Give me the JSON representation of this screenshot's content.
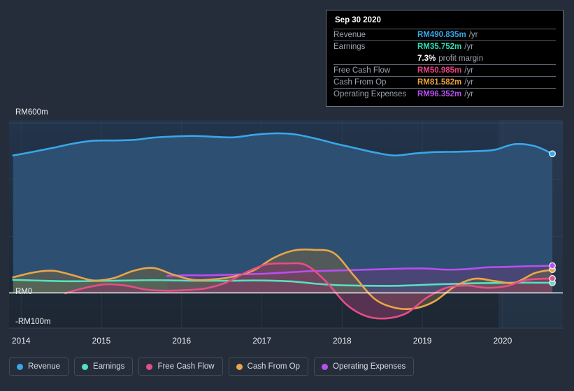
{
  "theme": {
    "background": "#262d3a",
    "plot_bg_top": "#22344b",
    "plot_bg_bottom": "#1d2733",
    "axis_text": "#e9edf2",
    "grid": "#3a4656",
    "zero_line": "#ffffff",
    "forecast_band": "#2c4059",
    "tooltip_bg": "#000000",
    "tooltip_border": "#6d747f",
    "tooltip_rule": "#5d646f",
    "tooltip_key": "#9aa1ac"
  },
  "tooltip": {
    "date": "Sep 30 2020",
    "rows": [
      {
        "key": "Revenue",
        "value": "RM490.835m",
        "unit": "/yr",
        "color": "#3aa6e8"
      },
      {
        "key": "Earnings",
        "value": "RM35.752m",
        "unit": "/yr",
        "color": "#2ee0b4"
      },
      {
        "key": "Free Cash Flow",
        "value": "RM50.985m",
        "unit": "/yr",
        "color": "#e8417f"
      },
      {
        "key": "Cash From Op",
        "value": "RM81.582m",
        "unit": "/yr",
        "color": "#e8a33d"
      },
      {
        "key": "Operating Expenses",
        "value": "RM96.352m",
        "unit": "/yr",
        "color": "#b44ff0"
      }
    ],
    "margin_value": "7.3%",
    "margin_label": "profit margin"
  },
  "legend": {
    "items": [
      {
        "label": "Revenue",
        "color": "#3aa6e8"
      },
      {
        "label": "Earnings",
        "color": "#56e0c0"
      },
      {
        "label": "Free Cash Flow",
        "color": "#e34f86"
      },
      {
        "label": "Cash From Op",
        "color": "#e8a64a"
      },
      {
        "label": "Operating Expenses",
        "color": "#b84ff0"
      }
    ]
  },
  "chart_data": {
    "type": "area",
    "title": "",
    "xlabel": "",
    "ylabel": "",
    "currency": "RM",
    "grid": true,
    "legend_position": "bottom",
    "ylim": [
      -100,
      600
    ],
    "y_ticks": [
      {
        "value": 600,
        "label": "RM600m"
      },
      {
        "value": 0,
        "label": "RM0"
      },
      {
        "value": -100,
        "label": "-RM100m"
      }
    ],
    "x_tick_labels": [
      "2014",
      "2015",
      "2016",
      "2017",
      "2018",
      "2019",
      "2020"
    ],
    "x_range": [
      2013.85,
      2020.75
    ],
    "forecast_start": "2019.95",
    "series": [
      {
        "name": "Revenue",
        "color": "#3aa6e8",
        "fill": "#2d4f72",
        "x": [
          2013.9,
          2014.15,
          2014.4,
          2014.65,
          2014.9,
          2015.15,
          2015.4,
          2015.65,
          2015.9,
          2016.15,
          2016.4,
          2016.65,
          2016.9,
          2017.15,
          2017.4,
          2017.65,
          2017.9,
          2018.15,
          2018.4,
          2018.65,
          2018.9,
          2019.15,
          2019.4,
          2019.65,
          2019.9,
          2020.15,
          2020.4,
          2020.62
        ],
        "values": [
          485,
          498,
          512,
          527,
          537,
          538,
          540,
          548,
          552,
          554,
          551,
          549,
          558,
          563,
          560,
          546,
          528,
          512,
          496,
          485,
          492,
          497,
          498,
          500,
          505,
          525,
          518,
          491
        ]
      },
      {
        "name": "Earnings",
        "color": "#56e0c0",
        "fill": "#3e6e6a",
        "x": [
          2013.9,
          2014.15,
          2014.4,
          2014.65,
          2014.9,
          2015.15,
          2015.4,
          2015.65,
          2015.9,
          2016.15,
          2016.4,
          2016.65,
          2016.9,
          2017.15,
          2017.4,
          2017.65,
          2017.9,
          2018.15,
          2018.4,
          2018.65,
          2018.9,
          2019.15,
          2019.4,
          2019.65,
          2019.9,
          2020.15,
          2020.4,
          2020.62
        ],
        "values": [
          46,
          44,
          42,
          41,
          42,
          43,
          44,
          45,
          44,
          43,
          43,
          43,
          44,
          43,
          40,
          33,
          28,
          26,
          25,
          25,
          27,
          30,
          32,
          34,
          35,
          36,
          36,
          36
        ]
      },
      {
        "name": "Free Cash Flow",
        "color": "#e34f86",
        "fill": "#7a3a63",
        "x": [
          2014.55,
          2014.8,
          2015.05,
          2015.3,
          2015.55,
          2015.8,
          2016.05,
          2016.3,
          2016.55,
          2016.8,
          2017.05,
          2017.3,
          2017.55,
          2017.8,
          2018.05,
          2018.3,
          2018.55,
          2018.8,
          2019.05,
          2019.3,
          2019.55,
          2019.8,
          2020.05,
          2020.3,
          2020.62
        ],
        "values": [
          -1,
          18,
          30,
          26,
          12,
          8,
          10,
          16,
          36,
          72,
          100,
          104,
          98,
          40,
          -40,
          -82,
          -90,
          -72,
          -18,
          18,
          26,
          18,
          24,
          46,
          51
        ]
      },
      {
        "name": "Cash From Op",
        "color": "#e8a64a",
        "fill": "#6f6346",
        "x": [
          2013.9,
          2014.15,
          2014.4,
          2014.65,
          2014.9,
          2015.15,
          2015.4,
          2015.65,
          2015.9,
          2016.15,
          2016.4,
          2016.65,
          2016.9,
          2017.15,
          2017.4,
          2017.65,
          2017.9,
          2018.15,
          2018.4,
          2018.65,
          2018.9,
          2019.15,
          2019.4,
          2019.65,
          2019.9,
          2020.15,
          2020.4,
          2020.62
        ],
        "values": [
          55,
          72,
          78,
          62,
          44,
          52,
          78,
          88,
          64,
          46,
          48,
          58,
          80,
          124,
          150,
          152,
          140,
          60,
          -20,
          -52,
          -55,
          -30,
          22,
          50,
          42,
          36,
          70,
          82
        ]
      },
      {
        "name": "Operating Expenses",
        "color": "#b84ff0",
        "fill": "#5a3f78",
        "x": [
          2015.82,
          2016.05,
          2016.3,
          2016.55,
          2016.8,
          2017.05,
          2017.3,
          2017.55,
          2017.8,
          2018.05,
          2018.3,
          2018.55,
          2018.8,
          2019.05,
          2019.3,
          2019.55,
          2019.8,
          2020.05,
          2020.3,
          2020.62
        ],
        "values": [
          60,
          62,
          62,
          64,
          66,
          68,
          72,
          76,
          78,
          80,
          82,
          84,
          86,
          86,
          82,
          84,
          90,
          92,
          94,
          96
        ]
      }
    ]
  }
}
